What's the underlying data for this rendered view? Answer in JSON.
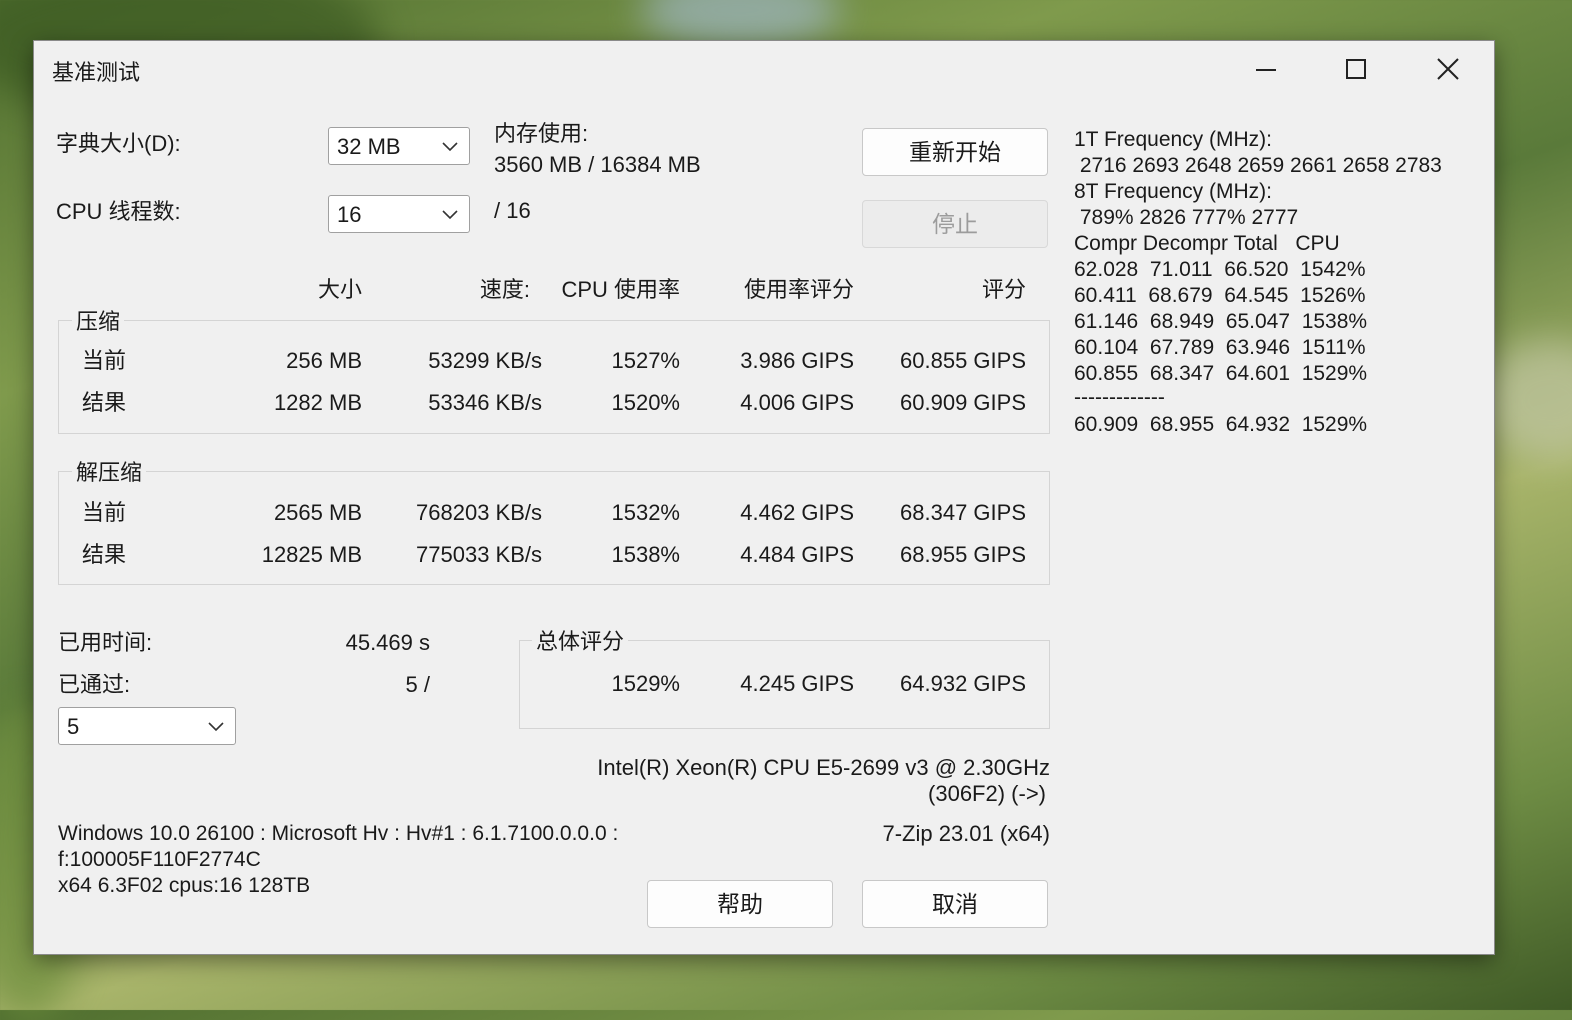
{
  "window": {
    "title": "基准测试",
    "controls": [
      "minimize-icon",
      "maximize-icon",
      "close-icon"
    ]
  },
  "settings": {
    "dict_label": "字典大小(D):",
    "dict_value": "32 MB",
    "threads_label": "CPU 线程数:",
    "threads_value": "16",
    "threads_total": "/ 16",
    "memory_label": "内存使用:",
    "memory_value": "3560 MB / 16384 MB"
  },
  "buttons": {
    "restart": "重新开始",
    "stop": "停止",
    "help": "帮助",
    "cancel": "取消"
  },
  "table": {
    "headers": [
      "大小",
      "速度:",
      "CPU 使用率",
      "使用率评分",
      "评分"
    ],
    "compress": {
      "label": "压缩",
      "current": {
        "label": "当前",
        "size": "256 MB",
        "speed": "53299 KB/s",
        "cpu": "1527%",
        "rating": "3.986 GIPS",
        "score": "60.855 GIPS"
      },
      "result": {
        "label": "结果",
        "size": "1282 MB",
        "speed": "53346 KB/s",
        "cpu": "1520%",
        "rating": "4.006 GIPS",
        "score": "60.909 GIPS"
      }
    },
    "decompress": {
      "label": "解压缩",
      "current": {
        "label": "当前",
        "size": "2565 MB",
        "speed": "768203 KB/s",
        "cpu": "1532%",
        "rating": "4.462 GIPS",
        "score": "68.347 GIPS"
      },
      "result": {
        "label": "结果",
        "size": "12825 MB",
        "speed": "775033 KB/s",
        "cpu": "1538%",
        "rating": "4.484 GIPS",
        "score": "68.955 GIPS"
      }
    }
  },
  "summary": {
    "elapsed_label": "已用时间:",
    "elapsed_value": "45.469 s",
    "passed_label": "已通过:",
    "passed_value": "5 /",
    "passes_select": "5",
    "total_label": "总体评分",
    "total_cpu": "1529%",
    "total_rating": "4.245 GIPS",
    "total_score": "64.932 GIPS"
  },
  "system": {
    "cpu_line1": "Intel(R) Xeon(R) CPU E5-2699 v3 @ 2.30GHz",
    "cpu_line2": "(306F2) (->)",
    "os_line1": "Windows 10.0 26100 : Microsoft Hv : Hv#1 : 6.1.7100.0.0.0 :",
    "os_line2": "f:100005F110F2774C",
    "os_line3": "x64 6.3F02 cpus:16 128TB",
    "version": "7-Zip 23.01 (x64)"
  },
  "log": {
    "freq1_label": "1T Frequency (MHz):",
    "freq1_values": " 2716 2693 2648 2659 2661 2658 2783",
    "freq8_label": "8T Frequency (MHz):",
    "freq8_values": " 789% 2826 777% 2777",
    "header": "Compr Decompr Total   CPU",
    "rows": [
      "62.028  71.011  66.520  1542%",
      "60.411  68.679  64.545  1526%",
      "61.146  68.949  65.047  1538%",
      "60.104  67.789  63.946  1511%",
      "60.855  68.347  64.601  1529%"
    ],
    "separator": "-------------",
    "total": "60.909  68.955  64.932  1529%"
  }
}
